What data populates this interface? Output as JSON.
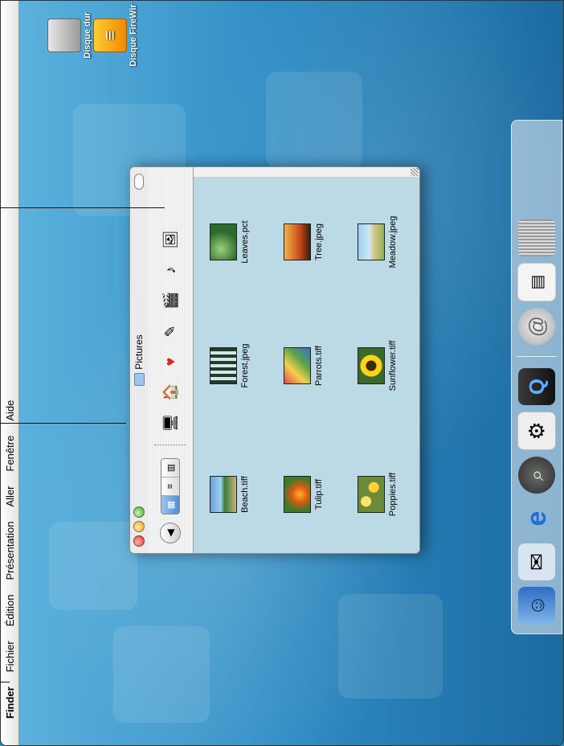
{
  "menubar": {
    "items": [
      "Finder",
      "Fichier",
      "Édition",
      "Présentation",
      "Aller",
      "Fenêtre",
      "Aide"
    ]
  },
  "desktop": {
    "disks": [
      {
        "label": "Disque dur",
        "icon": "hard-disk-icon"
      },
      {
        "label": "Disque FireWir",
        "icon": "firewire-disk-icon"
      }
    ]
  },
  "window": {
    "title": "Pictures",
    "toolbar_icons": [
      "back-icon",
      "view-icons-icon",
      "view-list-icon",
      "view-columns-icon",
      "computer-icon",
      "home-icon",
      "favorites-icon",
      "applications-icon",
      "movies-icon",
      "music-icon",
      "pictures-icon"
    ],
    "files": [
      {
        "name": "Beach.tiff"
      },
      {
        "name": "Forest.jpeg"
      },
      {
        "name": "Leaves.pct"
      },
      {
        "name": "Tulip.tiff"
      },
      {
        "name": "Parrots.tiff"
      },
      {
        "name": "Tree.jpeg"
      },
      {
        "name": "Poppies.tiff"
      },
      {
        "name": "Sunflower.tiff"
      },
      {
        "name": "Meadow.jpeg"
      }
    ]
  },
  "dock": {
    "apps": [
      "finder-icon",
      "mail-icon",
      "internet-explorer-icon",
      "sherlock-icon",
      "system-preferences-icon",
      "quicktime-icon"
    ],
    "others": [
      "internet-location-icon",
      "documents-icon",
      "trash-icon"
    ]
  }
}
